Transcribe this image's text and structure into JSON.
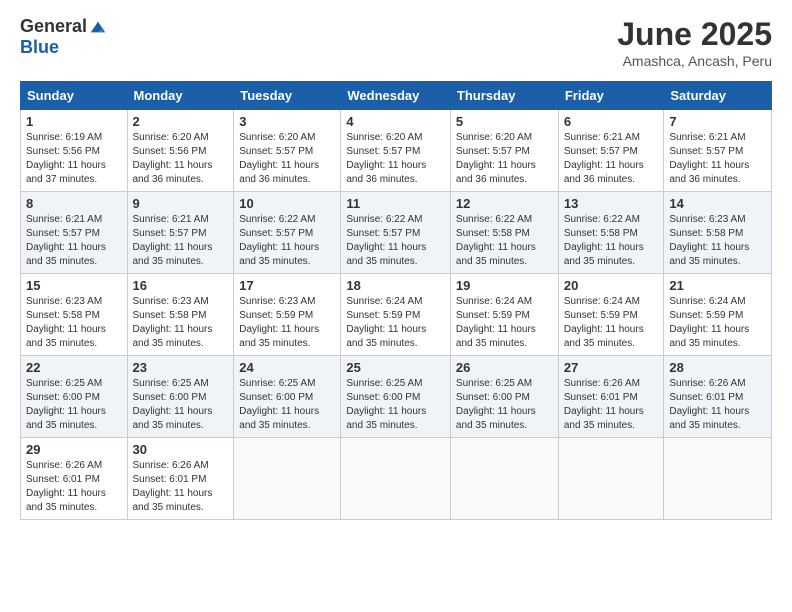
{
  "logo": {
    "general": "General",
    "blue": "Blue"
  },
  "title": {
    "month": "June 2025",
    "location": "Amashca, Ancash, Peru"
  },
  "weekdays": [
    "Sunday",
    "Monday",
    "Tuesday",
    "Wednesday",
    "Thursday",
    "Friday",
    "Saturday"
  ],
  "weeks": [
    [
      {
        "day": "1",
        "sunrise": "Sunrise: 6:19 AM",
        "sunset": "Sunset: 5:56 PM",
        "daylight": "Daylight: 11 hours and 37 minutes."
      },
      {
        "day": "2",
        "sunrise": "Sunrise: 6:20 AM",
        "sunset": "Sunset: 5:56 PM",
        "daylight": "Daylight: 11 hours and 36 minutes."
      },
      {
        "day": "3",
        "sunrise": "Sunrise: 6:20 AM",
        "sunset": "Sunset: 5:57 PM",
        "daylight": "Daylight: 11 hours and 36 minutes."
      },
      {
        "day": "4",
        "sunrise": "Sunrise: 6:20 AM",
        "sunset": "Sunset: 5:57 PM",
        "daylight": "Daylight: 11 hours and 36 minutes."
      },
      {
        "day": "5",
        "sunrise": "Sunrise: 6:20 AM",
        "sunset": "Sunset: 5:57 PM",
        "daylight": "Daylight: 11 hours and 36 minutes."
      },
      {
        "day": "6",
        "sunrise": "Sunrise: 6:21 AM",
        "sunset": "Sunset: 5:57 PM",
        "daylight": "Daylight: 11 hours and 36 minutes."
      },
      {
        "day": "7",
        "sunrise": "Sunrise: 6:21 AM",
        "sunset": "Sunset: 5:57 PM",
        "daylight": "Daylight: 11 hours and 36 minutes."
      }
    ],
    [
      {
        "day": "8",
        "sunrise": "Sunrise: 6:21 AM",
        "sunset": "Sunset: 5:57 PM",
        "daylight": "Daylight: 11 hours and 35 minutes."
      },
      {
        "day": "9",
        "sunrise": "Sunrise: 6:21 AM",
        "sunset": "Sunset: 5:57 PM",
        "daylight": "Daylight: 11 hours and 35 minutes."
      },
      {
        "day": "10",
        "sunrise": "Sunrise: 6:22 AM",
        "sunset": "Sunset: 5:57 PM",
        "daylight": "Daylight: 11 hours and 35 minutes."
      },
      {
        "day": "11",
        "sunrise": "Sunrise: 6:22 AM",
        "sunset": "Sunset: 5:57 PM",
        "daylight": "Daylight: 11 hours and 35 minutes."
      },
      {
        "day": "12",
        "sunrise": "Sunrise: 6:22 AM",
        "sunset": "Sunset: 5:58 PM",
        "daylight": "Daylight: 11 hours and 35 minutes."
      },
      {
        "day": "13",
        "sunrise": "Sunrise: 6:22 AM",
        "sunset": "Sunset: 5:58 PM",
        "daylight": "Daylight: 11 hours and 35 minutes."
      },
      {
        "day": "14",
        "sunrise": "Sunrise: 6:23 AM",
        "sunset": "Sunset: 5:58 PM",
        "daylight": "Daylight: 11 hours and 35 minutes."
      }
    ],
    [
      {
        "day": "15",
        "sunrise": "Sunrise: 6:23 AM",
        "sunset": "Sunset: 5:58 PM",
        "daylight": "Daylight: 11 hours and 35 minutes."
      },
      {
        "day": "16",
        "sunrise": "Sunrise: 6:23 AM",
        "sunset": "Sunset: 5:58 PM",
        "daylight": "Daylight: 11 hours and 35 minutes."
      },
      {
        "day": "17",
        "sunrise": "Sunrise: 6:23 AM",
        "sunset": "Sunset: 5:59 PM",
        "daylight": "Daylight: 11 hours and 35 minutes."
      },
      {
        "day": "18",
        "sunrise": "Sunrise: 6:24 AM",
        "sunset": "Sunset: 5:59 PM",
        "daylight": "Daylight: 11 hours and 35 minutes."
      },
      {
        "day": "19",
        "sunrise": "Sunrise: 6:24 AM",
        "sunset": "Sunset: 5:59 PM",
        "daylight": "Daylight: 11 hours and 35 minutes."
      },
      {
        "day": "20",
        "sunrise": "Sunrise: 6:24 AM",
        "sunset": "Sunset: 5:59 PM",
        "daylight": "Daylight: 11 hours and 35 minutes."
      },
      {
        "day": "21",
        "sunrise": "Sunrise: 6:24 AM",
        "sunset": "Sunset: 5:59 PM",
        "daylight": "Daylight: 11 hours and 35 minutes."
      }
    ],
    [
      {
        "day": "22",
        "sunrise": "Sunrise: 6:25 AM",
        "sunset": "Sunset: 6:00 PM",
        "daylight": "Daylight: 11 hours and 35 minutes."
      },
      {
        "day": "23",
        "sunrise": "Sunrise: 6:25 AM",
        "sunset": "Sunset: 6:00 PM",
        "daylight": "Daylight: 11 hours and 35 minutes."
      },
      {
        "day": "24",
        "sunrise": "Sunrise: 6:25 AM",
        "sunset": "Sunset: 6:00 PM",
        "daylight": "Daylight: 11 hours and 35 minutes."
      },
      {
        "day": "25",
        "sunrise": "Sunrise: 6:25 AM",
        "sunset": "Sunset: 6:00 PM",
        "daylight": "Daylight: 11 hours and 35 minutes."
      },
      {
        "day": "26",
        "sunrise": "Sunrise: 6:25 AM",
        "sunset": "Sunset: 6:00 PM",
        "daylight": "Daylight: 11 hours and 35 minutes."
      },
      {
        "day": "27",
        "sunrise": "Sunrise: 6:26 AM",
        "sunset": "Sunset: 6:01 PM",
        "daylight": "Daylight: 11 hours and 35 minutes."
      },
      {
        "day": "28",
        "sunrise": "Sunrise: 6:26 AM",
        "sunset": "Sunset: 6:01 PM",
        "daylight": "Daylight: 11 hours and 35 minutes."
      }
    ],
    [
      {
        "day": "29",
        "sunrise": "Sunrise: 6:26 AM",
        "sunset": "Sunset: 6:01 PM",
        "daylight": "Daylight: 11 hours and 35 minutes."
      },
      {
        "day": "30",
        "sunrise": "Sunrise: 6:26 AM",
        "sunset": "Sunset: 6:01 PM",
        "daylight": "Daylight: 11 hours and 35 minutes."
      },
      null,
      null,
      null,
      null,
      null
    ]
  ]
}
